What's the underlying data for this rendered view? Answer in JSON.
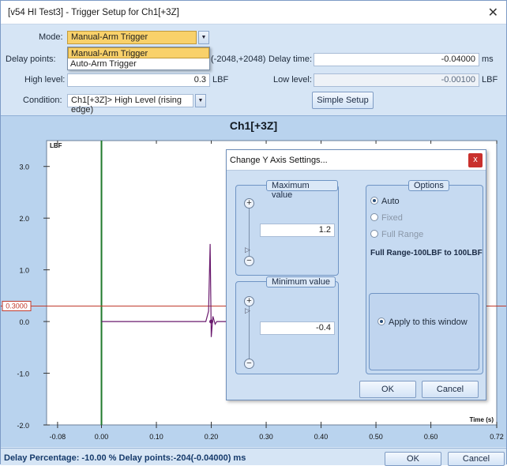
{
  "window": {
    "title": "[v54 HI Test3] - Trigger Setup for Ch1[+3Z]",
    "close_glyph": "✕"
  },
  "form": {
    "mode_label": "Mode:",
    "mode_value": "Manual-Arm Trigger",
    "mode_options": [
      "Manual-Arm Trigger",
      "Auto-Arm Trigger"
    ],
    "delay_points_label": "Delay points:",
    "delay_points_range": "(-2048,+2048)",
    "delay_time_label": "Delay time:",
    "delay_time_value": "-0.04000",
    "delay_time_unit": "ms",
    "high_level_label": "High level:",
    "high_level_value": "0.3",
    "high_level_unit": "LBF",
    "low_level_label": "Low level:",
    "low_level_value": "-0.00100",
    "low_level_unit": "LBF",
    "condition_label": "Condition:",
    "condition_value": "Ch1[+3Z]> High Level (rising edge)",
    "simple_setup_button": "Simple Setup"
  },
  "chart_data": {
    "type": "line",
    "title": "Ch1[+3Z]",
    "ylabel": "LBF",
    "xlabel": "Time (s)",
    "xlim": [
      -0.1,
      0.72
    ],
    "ylim": [
      -2.0,
      3.5
    ],
    "x_ticks": [
      "-0.08",
      "0.00",
      "0.10",
      "0.20",
      "0.30",
      "0.40",
      "0.50",
      "0.60",
      "0.72"
    ],
    "x_tick_values": [
      -0.08,
      0.0,
      0.1,
      0.2,
      0.3,
      0.4,
      0.5,
      0.6,
      0.72
    ],
    "y_ticks": [
      "3.0",
      "2.0",
      "1.0",
      "0.0",
      "-1.0",
      "-2.0"
    ],
    "y_tick_values": [
      3.0,
      2.0,
      1.0,
      0.0,
      -1.0,
      -2.0
    ],
    "trigger_level_label": "0.3000",
    "trigger_level": 0.3,
    "delay_marker_x": 0.0,
    "series": [
      {
        "color": "#6a1a6e",
        "x": [
          0.0,
          0.05,
          0.1,
          0.15,
          0.19,
          0.195,
          0.198,
          0.2,
          0.203,
          0.207,
          0.21,
          0.25,
          0.3
        ],
        "y": [
          0.0,
          0.0,
          0.0,
          0.0,
          0.0,
          0.2,
          1.5,
          -0.3,
          0.1,
          -0.05,
          0.0,
          0.0,
          0.0
        ]
      }
    ]
  },
  "status": {
    "text": "Delay Percentage: -10.00 % Delay points:-204(-0.04000) ms"
  },
  "footer": {
    "ok_label": "OK",
    "cancel_label": "Cancel"
  },
  "dialog": {
    "title": "Change Y Axis Settings...",
    "close_glyph": "x",
    "max_caption": "Maximum value",
    "max_value": "1.2",
    "min_caption": "Minimum value",
    "min_value": "-0.4",
    "options_caption": "Options",
    "opt_auto": "Auto",
    "opt_fixed": "Fixed",
    "opt_full": "Full Range",
    "full_range_text": "Full Range-100LBF to 100LBF",
    "apply_label": "Apply to this window",
    "ok_label": "OK",
    "cancel_label": "Cancel"
  },
  "colors": {
    "accent": "#f9d16a",
    "trigger_line": "#c0392b",
    "marker_line": "#1f7a2c",
    "chart_bg": "#b9d3ee",
    "plot_bg": "#ffffff"
  }
}
